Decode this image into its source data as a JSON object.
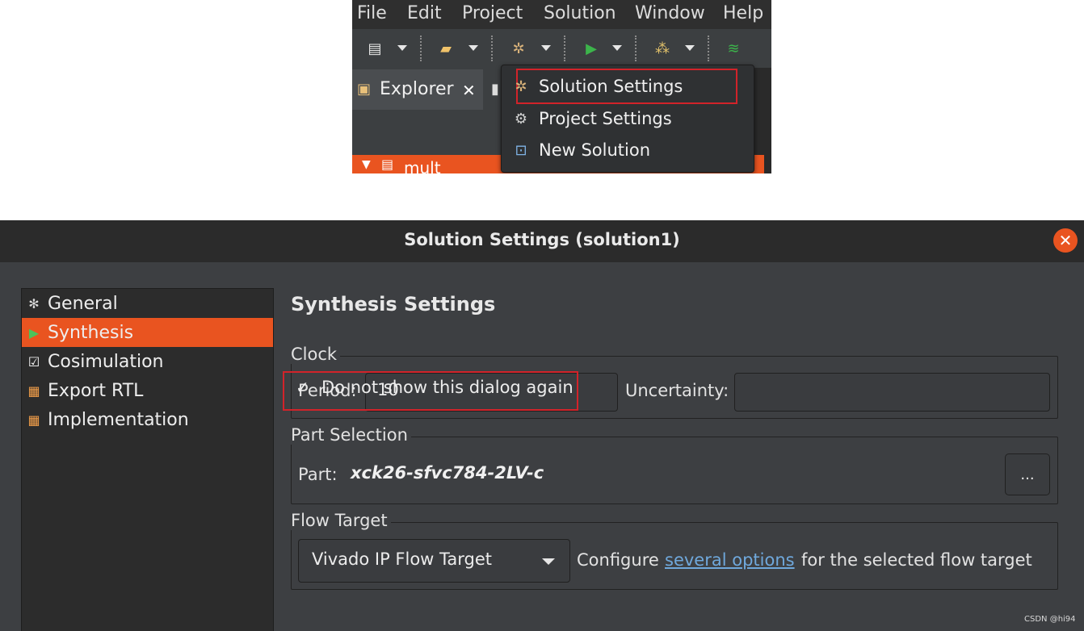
{
  "ide": {
    "menu": [
      "File",
      "Edit",
      "Project",
      "Solution",
      "Window",
      "Help"
    ],
    "toolbar_icons": [
      "new-file-icon",
      "open-folder-icon",
      "settings-gear-icon",
      "run-play-icon",
      "hierarchy-icon",
      "waveform-icon"
    ],
    "explorer_tab": {
      "label": "Explorer",
      "close": "✕"
    },
    "tree_project": "mult",
    "dropdown": {
      "items": [
        {
          "label": "Solution Settings",
          "icon": "solution-settings-icon",
          "highlighted": true
        },
        {
          "label": "Project Settings",
          "icon": "project-settings-icon"
        },
        {
          "label": "New Solution",
          "icon": "new-solution-icon"
        }
      ]
    }
  },
  "dialog": {
    "title": "Solution Settings (solution1)",
    "close_glyph": "✕",
    "nav": [
      {
        "label": "General",
        "icon": "general-gear-icon",
        "active": false
      },
      {
        "label": "Synthesis",
        "icon": "synthesis-play-icon",
        "active": true
      },
      {
        "label": "Cosimulation",
        "icon": "cosim-checkbox-icon",
        "active": false
      },
      {
        "label": "Export RTL",
        "icon": "export-grid-icon",
        "active": false
      },
      {
        "label": "Implementation",
        "icon": "implementation-grid-icon",
        "active": false
      }
    ],
    "section_title": "Synthesis Settings",
    "clock": {
      "group_label": "Clock",
      "period_label": "Period:",
      "period_value": "10",
      "uncertainty_label": "Uncertainty:",
      "uncertainty_value": ""
    },
    "part": {
      "group_label": "Part Selection",
      "label": "Part:",
      "value": "xck26-sfvc784-2LV-c",
      "browse_label": "..."
    },
    "flow": {
      "group_label": "Flow Target",
      "selected": "Vivado IP Flow Target",
      "text_before": "Configure",
      "link_text": "several options",
      "text_after": "for the selected flow target"
    },
    "dont_show": {
      "checked": true,
      "check_glyph": "✓",
      "label": "Do not show this dialog again"
    }
  },
  "watermark": "CSDN @hi94",
  "colors": {
    "accent": "#e95420",
    "highlight_box": "#d2232a",
    "link": "#6fa8dc"
  }
}
